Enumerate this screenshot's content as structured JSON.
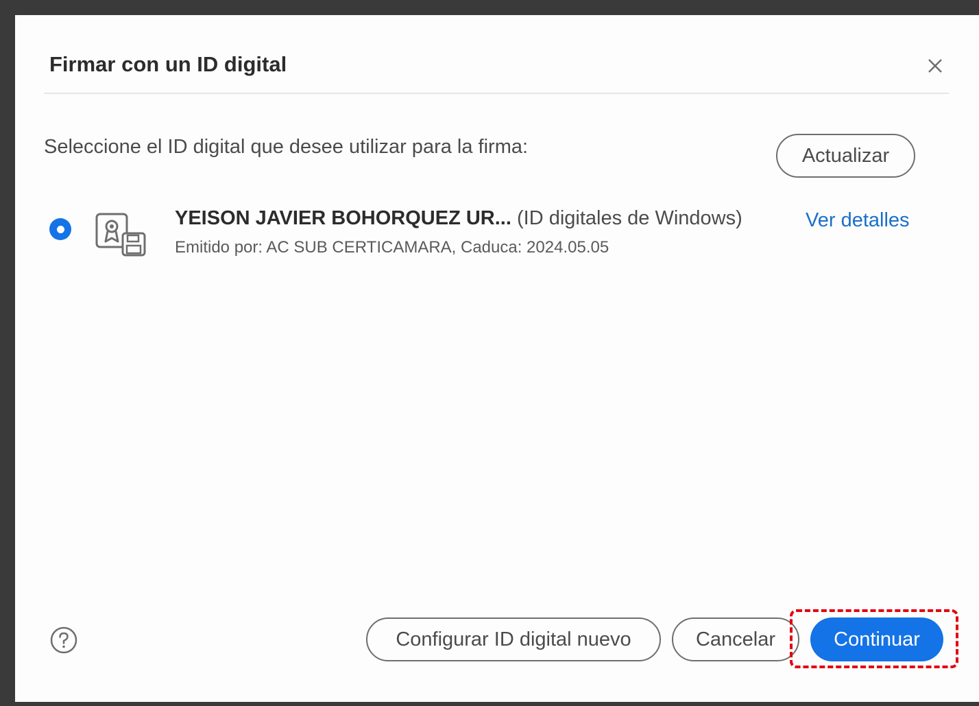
{
  "dialog": {
    "title": "Firmar con un ID digital",
    "close_icon": "close-icon",
    "prompt": "Seleccione el ID digital que desee utilizar para la firma:",
    "refresh_label": "Actualizar"
  },
  "digital_id": {
    "selected": true,
    "icon": "certificate-icon",
    "name": "YEISON JAVIER BOHORQUEZ UR...",
    "source": "(ID digitales de Windows)",
    "issuer_line": "Emitido por: AC SUB CERTICAMARA, Caduca: 2024.05.05",
    "details_link": "Ver detalles"
  },
  "footer": {
    "help_icon": "help-icon",
    "new_id_label": "Configurar ID digital nuevo",
    "cancel_label": "Cancelar",
    "continue_label": "Continuar"
  },
  "colors": {
    "accent": "#1473e6",
    "link": "#1a6fc9",
    "highlight": "#e3000f"
  }
}
